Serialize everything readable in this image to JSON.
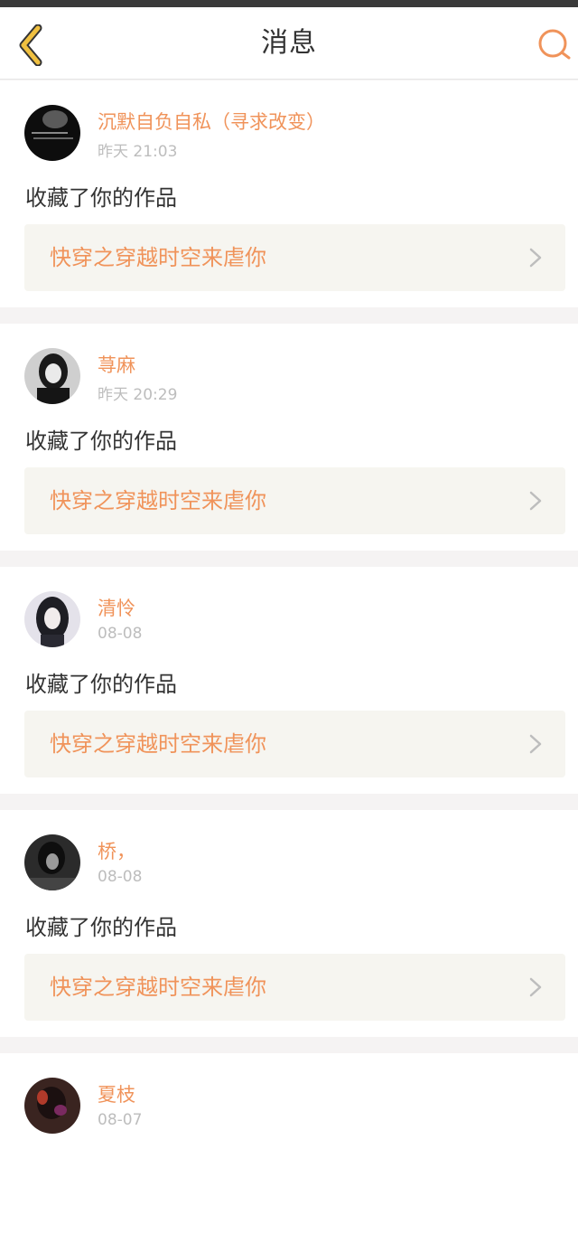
{
  "header": {
    "title": "消息",
    "back_icon": "chevron-left-icon",
    "search_icon": "search-icon",
    "accent": "#f0b43c"
  },
  "messages": [
    {
      "username": "沉默自负自私（寻求改变）",
      "time": "昨天 21:03",
      "action": "收藏了你的作品",
      "work": "快穿之穿越时空来虐你"
    },
    {
      "username": "荨麻",
      "time": "昨天 20:29",
      "action": "收藏了你的作品",
      "work": "快穿之穿越时空来虐你"
    },
    {
      "username": "清怜",
      "time": "08-08",
      "action": "收藏了你的作品",
      "work": "快穿之穿越时空来虐你"
    },
    {
      "username": "桥，",
      "time": "08-08",
      "action": "收藏了你的作品",
      "work": "快穿之穿越时空来虐你"
    },
    {
      "username": "夏枝",
      "time": "08-07"
    }
  ],
  "colors": {
    "username": "#f0935a",
    "work_title": "#f0935a",
    "time": "#bdbdbd",
    "card_link_bg": "#f6f5f0"
  }
}
